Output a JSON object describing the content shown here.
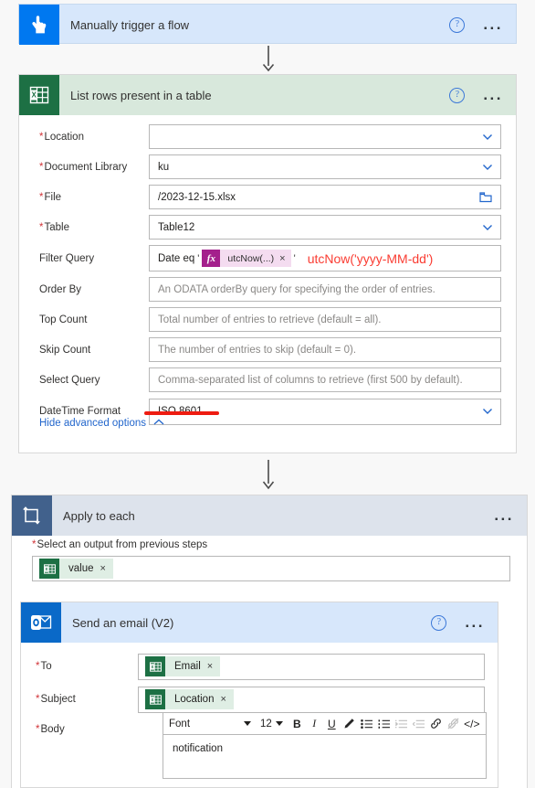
{
  "flow": {
    "trigger": {
      "title": "Manually trigger a flow",
      "icon": "hand-pointer-icon",
      "help": "?",
      "menu": "...",
      "accent": "#0078f0",
      "header_bg": "#d7e7fb"
    },
    "list_rows": {
      "title": "List rows present in a table",
      "icon": "excel-icon",
      "help": "?",
      "menu": "...",
      "accent": "#1d7044",
      "header_bg": "#d8e8dc",
      "fields": [
        {
          "label": "Location",
          "required": true,
          "value": "",
          "placeholder": "",
          "control": "dropdown"
        },
        {
          "label": "Document Library",
          "required": true,
          "value": "ku",
          "placeholder": "",
          "control": "dropdown"
        },
        {
          "label": "File",
          "required": true,
          "value": "/2023-12-15.xlsx",
          "placeholder": "",
          "control": "filepicker"
        },
        {
          "label": "Table",
          "required": true,
          "value": "Table12",
          "placeholder": "",
          "control": "dropdown"
        },
        {
          "label": "Filter Query",
          "required": false,
          "value": "",
          "placeholder": "",
          "control": "tokenized"
        },
        {
          "label": "Order By",
          "required": false,
          "value": "",
          "placeholder": "An ODATA orderBy query for specifying the order of entries.",
          "control": "text"
        },
        {
          "label": "Top Count",
          "required": false,
          "value": "",
          "placeholder": "Total number of entries to retrieve (default = all).",
          "control": "text"
        },
        {
          "label": "Skip Count",
          "required": false,
          "value": "",
          "placeholder": "The number of entries to skip (default = 0).",
          "control": "text"
        },
        {
          "label": "Select Query",
          "required": false,
          "value": "",
          "placeholder": "Comma-separated list of columns to retrieve (first 500 by default).",
          "control": "text"
        },
        {
          "label": "DateTime Format",
          "required": false,
          "value": "ISO 8601",
          "placeholder": "",
          "control": "dropdown"
        }
      ],
      "filter_query": {
        "prefix": "Date eq",
        "open_quote": "'",
        "token_fx": "fx",
        "token_label": "utcNow(...)",
        "token_close": "×",
        "close_quote": "'"
      },
      "advanced_link": "Hide advanced options"
    },
    "annotations": {
      "formula_note": "utcNow('yyyy-MM-dd')",
      "formula_note_color": "#fa3c32",
      "underline_color": "#ee1c11"
    },
    "apply_to_each": {
      "title": "Apply to each",
      "icon": "loop-icon",
      "menu": "...",
      "accent": "#41618c",
      "header_bg": "#dde3ec",
      "output_label": "Select an output from previous steps",
      "output_required": true,
      "output_token": {
        "label": "value",
        "close": "×",
        "icon": "excel-icon"
      }
    },
    "send_email": {
      "title": "Send an email (V2)",
      "icon": "outlook-icon",
      "help": "?",
      "menu": "...",
      "accent": "#0a69c8",
      "header_bg": "#d7e7fb",
      "to": {
        "label": "To",
        "required": true,
        "token": {
          "label": "Email",
          "close": "×",
          "icon": "excel-icon"
        }
      },
      "subject": {
        "label": "Subject",
        "required": true,
        "token": {
          "label": "Location",
          "close": "×",
          "icon": "excel-icon"
        }
      },
      "body": {
        "label": "Body",
        "required": true,
        "content": "notification",
        "toolbar": {
          "font_name": "Font",
          "font_size": "12",
          "bold": "B",
          "italic": "I",
          "underline": "U",
          "text_color": "pen-icon",
          "bulleted_list": "bulleted-list-icon",
          "numbered_list": "numbered-list-icon",
          "indent": "indent-icon",
          "outdent": "outdent-icon",
          "link": "link-icon",
          "unlink": "unlink-icon",
          "code_view": "</>"
        }
      }
    }
  }
}
